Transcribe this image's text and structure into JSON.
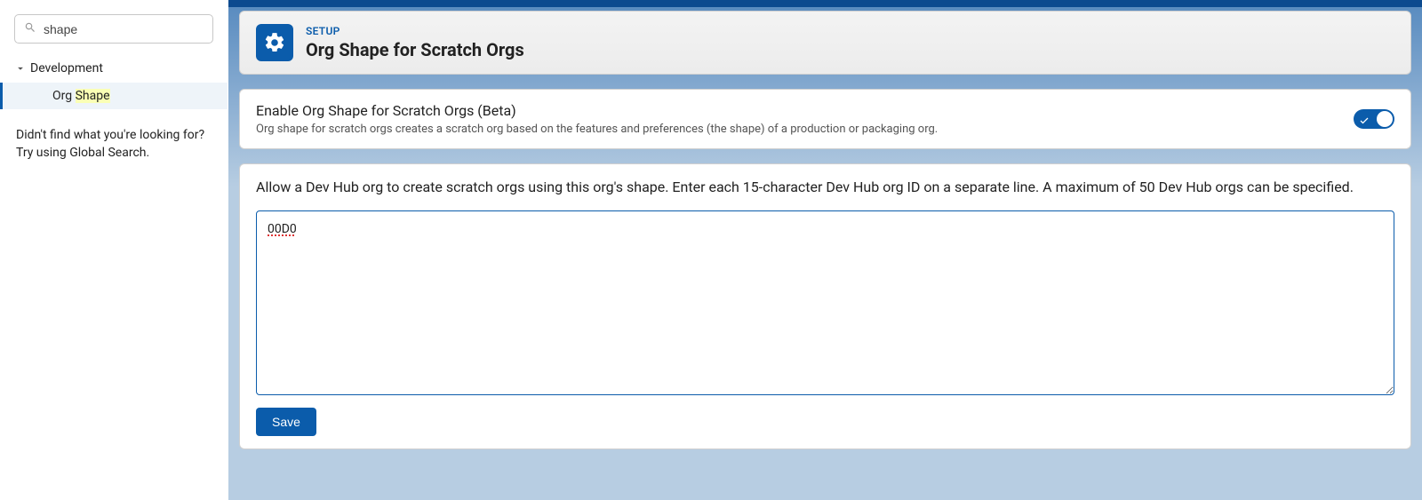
{
  "sidebar": {
    "search_value": "shape",
    "sections": [
      {
        "label": "Development",
        "expanded": true,
        "items": [
          {
            "prefix": "Org ",
            "highlight": "Shape"
          }
        ]
      }
    ],
    "help_line1": "Didn't find what you're looking for?",
    "help_line2": "Try using Global Search."
  },
  "header": {
    "eyebrow": "SETUP",
    "title": "Org Shape for Scratch Orgs"
  },
  "enable_panel": {
    "title": "Enable Org Shape for Scratch Orgs (Beta)",
    "description": "Org shape for scratch orgs creates a scratch org based on the features and preferences (the shape) of a production or packaging org.",
    "enabled": true
  },
  "devhub_panel": {
    "instructions": "Allow a Dev Hub org to create scratch orgs using this org's shape. Enter each 15-character Dev Hub org ID on a separate line. A maximum of 50 Dev Hub orgs can be specified.",
    "textarea_value": "00D0",
    "save_label": "Save"
  }
}
